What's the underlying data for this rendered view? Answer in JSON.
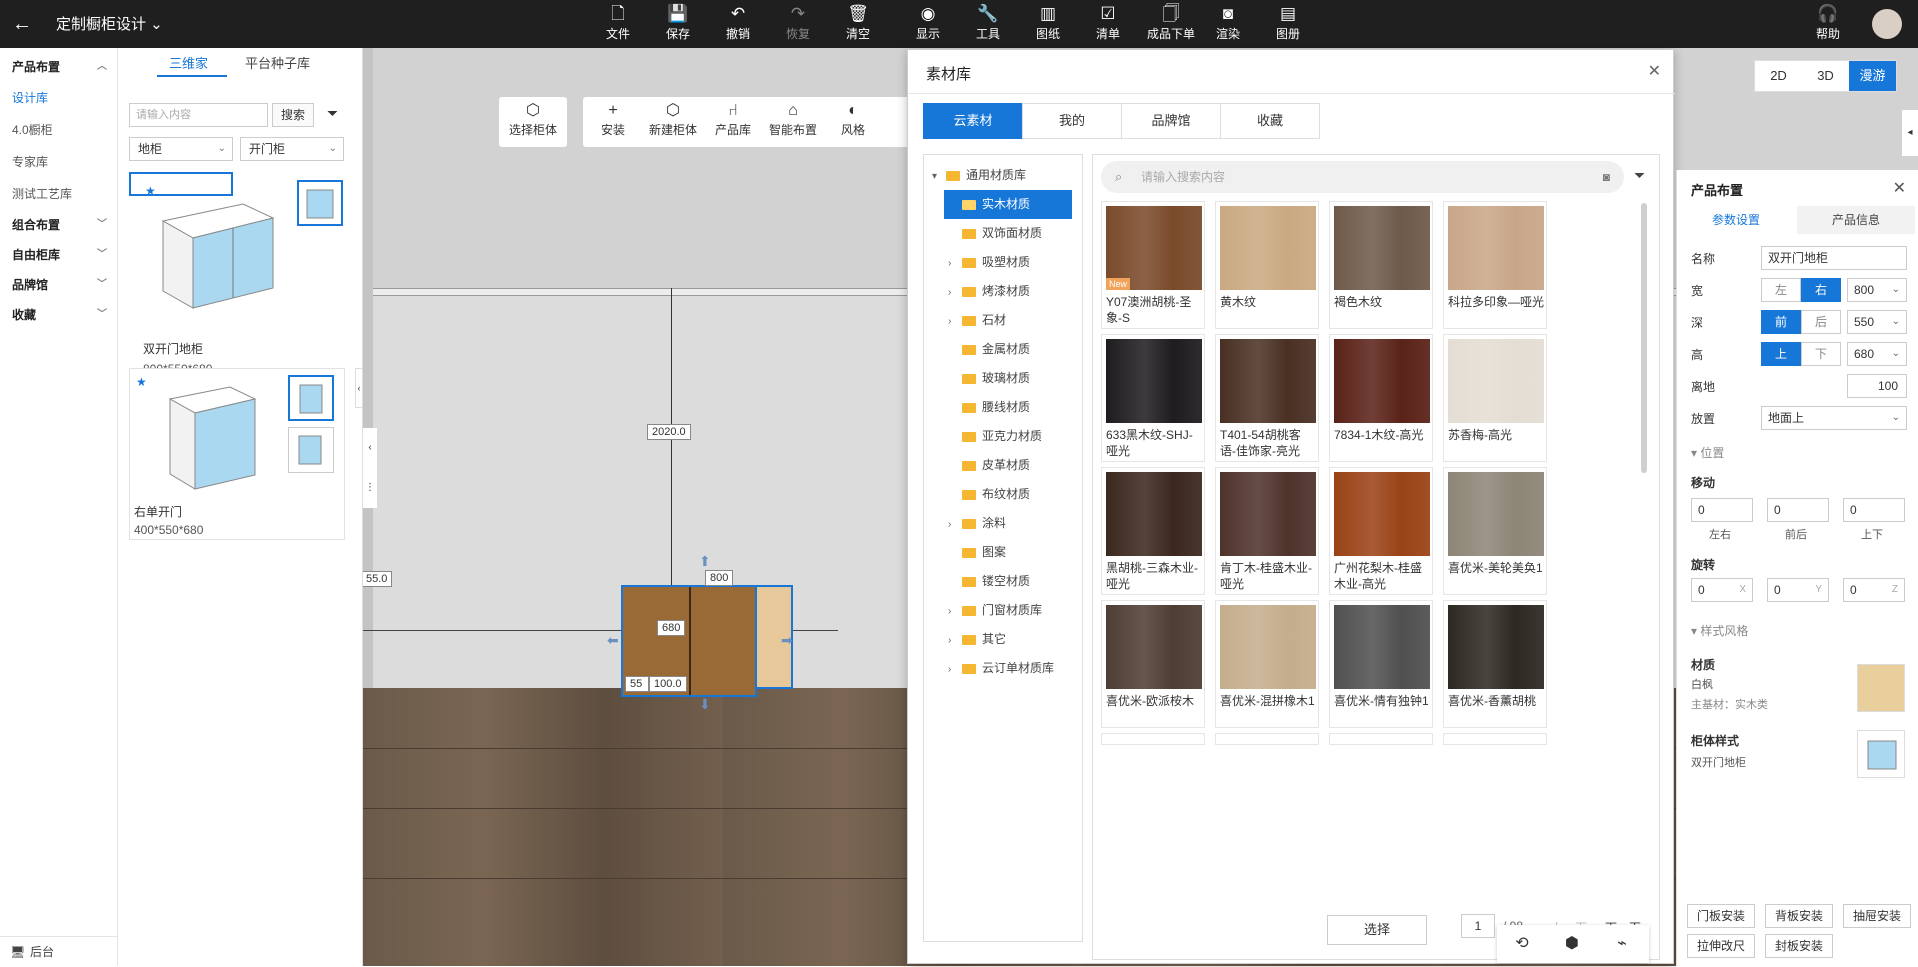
{
  "header": {
    "back_icon": "arrow-left-icon",
    "title": "定制橱柜设计",
    "tools": [
      {
        "label": "文件",
        "icon": "file-icon"
      },
      {
        "label": "保存",
        "icon": "save-icon"
      },
      {
        "label": "撤销",
        "icon": "undo-icon"
      },
      {
        "label": "恢复",
        "icon": "redo-icon"
      },
      {
        "label": "清空",
        "icon": "clear-icon"
      },
      {
        "label": "显示",
        "icon": "eye-icon"
      },
      {
        "label": "工具",
        "icon": "wrench-icon"
      },
      {
        "label": "图纸",
        "icon": "map-icon"
      },
      {
        "label": "清单",
        "icon": "checklist-icon"
      },
      {
        "label": "成品下单",
        "icon": "order-icon"
      },
      {
        "label": "渲染",
        "icon": "camera-icon"
      },
      {
        "label": "图册",
        "icon": "album-icon"
      }
    ],
    "help": "帮助"
  },
  "leftnav": {
    "section1": "产品布置",
    "items": [
      "设计库",
      "4.0橱柜",
      "专家库",
      "测试工艺库"
    ],
    "section2": "组合布置",
    "section3": "自由柜库",
    "section4": "品牌馆",
    "section5": "收藏",
    "footer": "后台"
  },
  "catalog": {
    "tab1": "三维家",
    "tab2": "平台种子库",
    "search_placeholder": "请输入内容",
    "search_btn": "搜索",
    "select1": "地柜",
    "select2": "开门柜",
    "cards": [
      {
        "name": "双开门地柜",
        "size": "800*550*680"
      },
      {
        "name": "右单开门",
        "size": "400*550*680"
      }
    ]
  },
  "canvas_tools": [
    {
      "label": "选择柜体",
      "icon": "cube-select-icon"
    },
    {
      "label": "安装",
      "icon": "plus-icon"
    },
    {
      "label": "新建柜体",
      "icon": "new-cabinet-icon"
    },
    {
      "label": "产品库",
      "icon": "chair-icon"
    },
    {
      "label": "智能布置",
      "icon": "smart-layout-icon"
    },
    {
      "label": "风格",
      "icon": "palette-icon"
    }
  ],
  "dims": {
    "height": "2020.0",
    "left": "55.0",
    "width": "800",
    "h680": "680",
    "bottom": "100.0",
    "bottom_left": "55"
  },
  "library": {
    "title": "素材库",
    "tabs": [
      "云素材",
      "我的",
      "品牌馆",
      "收藏"
    ],
    "tree": [
      {
        "label": "通用材质库",
        "caret": "▾",
        "level": 0
      },
      {
        "label": "实木材质",
        "caret": "",
        "level": 1,
        "active": true
      },
      {
        "label": "双饰面材质",
        "caret": "",
        "level": 1
      },
      {
        "label": "吸塑材质",
        "caret": "›",
        "level": 1
      },
      {
        "label": "烤漆材质",
        "caret": "›",
        "level": 1
      },
      {
        "label": "石材",
        "caret": "›",
        "level": 1
      },
      {
        "label": "金属材质",
        "caret": "",
        "level": 1
      },
      {
        "label": "玻璃材质",
        "caret": "",
        "level": 1
      },
      {
        "label": "腰线材质",
        "caret": "",
        "level": 1
      },
      {
        "label": "亚克力材质",
        "caret": "",
        "level": 1
      },
      {
        "label": "皮革材质",
        "caret": "",
        "level": 1
      },
      {
        "label": "布纹材质",
        "caret": "",
        "level": 1
      },
      {
        "label": "涂料",
        "caret": "›",
        "level": 1
      },
      {
        "label": "图案",
        "caret": "",
        "level": 1
      },
      {
        "label": "镂空材质",
        "caret": "",
        "level": 1
      },
      {
        "label": "门窗材质库",
        "caret": "›",
        "level": 1
      },
      {
        "label": "其它",
        "caret": "›",
        "level": 1
      },
      {
        "label": "云订单材质库",
        "caret": "›",
        "level": 1
      }
    ],
    "search_placeholder": "请输入搜索内容",
    "materials": [
      {
        "label": "Y07澳洲胡桃-圣象-S",
        "color": "#7a4a2a",
        "new": "New"
      },
      {
        "label": "黄木纹",
        "color": "#c9a982"
      },
      {
        "label": "褐色木纹",
        "color": "#6e5a4a"
      },
      {
        "label": "科拉多印象—哑光",
        "color": "#c8a689"
      },
      {
        "label": "633黑木纹-SHJ-哑光",
        "color": "#1f1c1f"
      },
      {
        "label": "T401-54胡桃客语-佳饰家-亮光",
        "color": "#4a3023"
      },
      {
        "label": "7834-1木纹-高光",
        "color": "#5a2218"
      },
      {
        "label": "苏香梅-高光",
        "color": "#e4ddd3"
      },
      {
        "label": "黑胡桃-三森木业-哑光",
        "color": "#3b271d"
      },
      {
        "label": "肯丁木-桂盛木业-哑光",
        "color": "#4e332b"
      },
      {
        "label": "广州花梨木-桂盛木业-高光",
        "color": "#9a4216"
      },
      {
        "label": "喜优米-美轮美奂1",
        "color": "#8d8576"
      },
      {
        "label": "喜优米-欧派桉木",
        "color": "#4e3d33"
      },
      {
        "label": "喜优米-混拼橡木1",
        "color": "#c4ad8c"
      },
      {
        "label": "喜优米-情有独钟1",
        "color": "#505050"
      },
      {
        "label": "喜优米-香薰胡桃",
        "color": "#2d2822"
      }
    ],
    "page": "1",
    "total": "/ 98",
    "prev": "上一页",
    "next": "下一页",
    "choose": "选择"
  },
  "view": {
    "a": "2D",
    "b": "3D",
    "c": "漫游"
  },
  "props": {
    "title": "产品布置",
    "tab1": "参数设置",
    "tab2": "产品信息",
    "name_label": "名称",
    "name_value": "双开门地柜",
    "width_label": "宽",
    "w_left": "左",
    "w_right": "右",
    "width_value": "800",
    "depth_label": "深",
    "d_front": "前",
    "d_back": "后",
    "depth_value": "550",
    "height_label": "高",
    "h_up": "上",
    "h_down": "下",
    "height_value": "680",
    "ground_label": "离地",
    "ground_value": "100",
    "place_label": "放置",
    "place_value": "地面上",
    "pos_section": "位置",
    "move_label": "移动",
    "move": [
      "0",
      "0",
      "0"
    ],
    "move_axes": [
      "左右",
      "前后",
      "上下"
    ],
    "rot_label": "旋转",
    "rot": [
      "0",
      "0",
      "0"
    ],
    "rot_axes": [
      "X",
      "Y",
      "Z"
    ],
    "style_section": "样式风格",
    "material_label": "材质",
    "material_value": "白枫",
    "material_base": "主基材：实木类",
    "cab_style_label": "柜体样式",
    "cab_style_value": "双开门地柜",
    "buttons": [
      "门板安装",
      "背板安装",
      "抽屉安装",
      "拉伸改尺",
      "封板安装"
    ]
  }
}
